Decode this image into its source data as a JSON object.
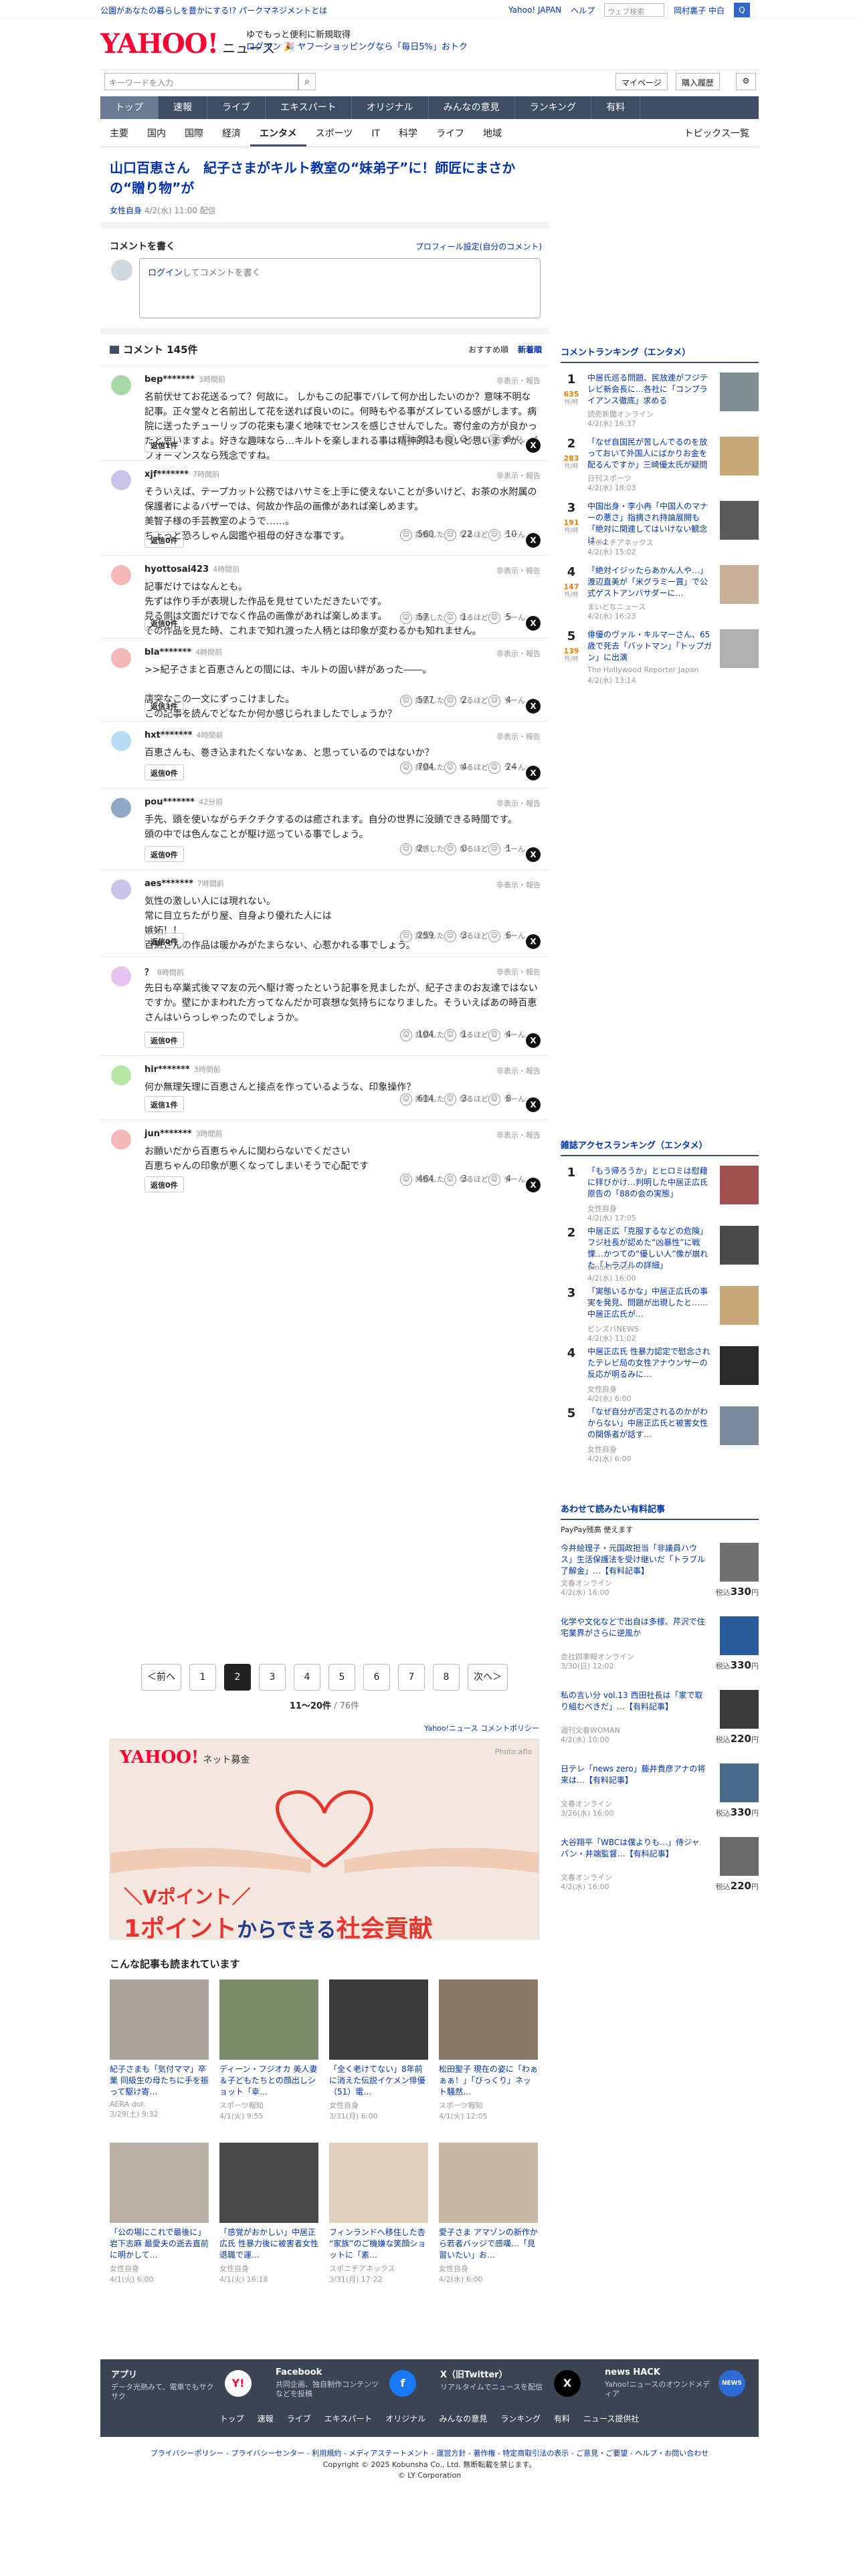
{
  "top": {
    "notice": "公園があなたの暮らしを豊かにする!? パークマネジメントとは",
    "links": [
      "Yahoo! JAPAN",
      "ヘルプ"
    ],
    "search_placeholder": "ウェブ検索",
    "location": "岡村裏子 中白",
    "search_button": "Q"
  },
  "header": {
    "logo": "YAHOO!",
    "logo_sub": "JAPAN",
    "site": "ニュース",
    "promo_line1": "ゆでもっと便利に新規取得",
    "promo_line2": "ログイン 🎉 ヤフーショッピングなら「毎日5%」おトク"
  },
  "searchbar": {
    "placeholder": "キーワードを入力",
    "icon": "search-icon",
    "mypage": "マイページ",
    "purchase": "購入履歴"
  },
  "nav": [
    "トップ",
    "速報",
    "ライブ",
    "エキスパート",
    "オリジナル",
    "みんなの意見",
    "ランキング",
    "有料"
  ],
  "subnav": [
    "主要",
    "国内",
    "国際",
    "経済",
    "エンタメ",
    "スポーツ",
    "IT",
    "科学",
    "ライフ",
    "地域"
  ],
  "subnav_right": "トピックス一覧",
  "article": {
    "title": "山口百恵さん　紀子さまがキルト教室の“妹弟子”に！師匠にまさかの“贈り物”が",
    "source": "女性自身",
    "date": "4/2(水) 11:00 配信"
  },
  "comment_write": {
    "title": "コメントを書く",
    "link": "プロフィール設定(自分のコメント)",
    "placeholder_link": "ログイン",
    "placeholder_rest": "してコメントを書く"
  },
  "comments_header": {
    "title": "コメント 145件",
    "sort_recommended": "おすすめ順",
    "sort_new": "新着順"
  },
  "report_label": "非表示・報告",
  "reaction_labels": {
    "a": "共感した",
    "b": "なるほど",
    "c": "うーん"
  },
  "comments": [
    {
      "user": "bep*******",
      "time": "3時間前",
      "avatar": "#a8d8a8",
      "text": "名前伏せてお花送るって？何故に。 しかもこの記事でバレて何か出したいのか？意味不明な記事。正々堂々と名前出して花を送れば良いのに。何時もやる事がズレている感がします。病院に送ったチューリップの花束も凄く地味でセンスを感じさせんでした。寄付金の方が良かったと思いますよ。好きな趣味なら…キルトを楽しまれる事は精神的にも良いと思いますが、パフォーマンスなら残念ですね。",
      "replies": "返信1件",
      "a": "303",
      "b": "3",
      "c": "8"
    },
    {
      "user": "xjf*******",
      "time": "7時間前",
      "avatar": "#c9c3e8",
      "text": "そういえば、テープカット公務ではハサミを上手に使えないことが多いけど、お茶の水附属の保護者によるバザーでは、何故か作品の画像があれば楽しめます。\n美智子様の手芸教室のようで……。\nちょっと恐ろしゃん図鑑や祖母の好きな事です。",
      "replies": "返信0件",
      "a": "560",
      "b": "22",
      "c": "10"
    },
    {
      "user": "hyottosai423",
      "time": "4時間前",
      "avatar": "#f5b8b8",
      "text": "記事だけではなんとも。\n先ずは作り手が表現した作品を見せていただきたいです。\n見る側は文面だけでなく作品の画像があれば楽しめます。\nその作品を見た時、これまで知れ渡った人柄とは印象が変わるかも知れません。",
      "replies": "返信0件",
      "a": "57",
      "b": "1",
      "c": "5"
    },
    {
      "user": "bla*******",
      "time": "4時間前",
      "avatar": "#f5b8b8",
      "text": ">>紀子さまと百恵さんとの間には、キルトの固い絆があった――。\n\n唐突なこの一文にずっこけました。\nこの記事を読んでどなたか何か感じられましたでしょうか？",
      "replies": "返信3件",
      "a": "577",
      "b": "2",
      "c": "4"
    },
    {
      "user": "hxt*******",
      "time": "4時間前",
      "avatar": "#b8dcf5",
      "text": "百恵さんも、巻き込まれたくないなぁ、と思っているのではないか？",
      "replies": "返信0件",
      "a": "704",
      "b": "4",
      "c": "24"
    },
    {
      "user": "pou*******",
      "time": "42分前",
      "avatar": "#8fa8c8",
      "text": "手先、頭を使いながらチクチクするのは癒されます。自分の世界に没頭できる時間です。\n頭の中では色んなことが駆け巡っている事でしょう。",
      "replies": "返信0件",
      "a": "2",
      "b": "0",
      "c": "1"
    },
    {
      "user": "aes*******",
      "time": "7時間前",
      "avatar": "#c9c3e8",
      "text": "気性の激しい人には現れない。\n常に目立ちたがり屋、自身より優れた人には\n嫉妬！！\n百恵さんの作品は暖かみがたまらない、心惹かれる事でしょう。",
      "replies": "返信0件",
      "a": "259",
      "b": "3",
      "c": "6"
    },
    {
      "user": "？",
      "time": "8時間前",
      "avatar": "#e6c3f0",
      "text": "先日も卒業式後ママ友の元へ駆け寄ったという記事を見ましたが、紀子さまのお友達ではないですか。壁にかまわれた方ってなんだか可哀想な気持ちになりました。そういえばあの時百恵さんはいらっしゃったのでしょうか。",
      "replies": "返信0件",
      "a": "104",
      "b": "1",
      "c": "4"
    },
    {
      "user": "hir*******",
      "time": "3時間前",
      "avatar": "#b8e6a8",
      "text": "何か無理矢理に百恵さんと接点を作っているような、印象操作？",
      "replies": "返信1件",
      "a": "614",
      "b": "3",
      "c": "8"
    },
    {
      "user": "jun*******",
      "time": "3時間前",
      "avatar": "#f5b8b8",
      "text": "お願いだから百恵ちゃんに関わらないでください\n百恵ちゃんの印象が悪くなってしまいそうで心配です",
      "replies": "返信0件",
      "a": "464",
      "b": "3",
      "c": "4"
    }
  ],
  "pager": {
    "prev": "＜前へ",
    "pages": [
      "1",
      "2",
      "3",
      "4",
      "5",
      "6",
      "7",
      "8"
    ],
    "current": "2",
    "next": "次へ＞",
    "info_bold": "11〜20件",
    "info_rest": " / 76件"
  },
  "policy": "Yahoo!ニュース コメントポリシー",
  "ad": {
    "logo": "YAHOO!",
    "logo_sub": "ネット募金",
    "photo": "Photo:aflo",
    "line1": "＼Vポイント／",
    "line2a": "1ポイント",
    "line2b": "からできる",
    "line2c": "社会貢献"
  },
  "recommended_title": "こんな記事も読まれています",
  "recommended": [
    {
      "title": "紀子さまも「気付ママ」卒業 同級生の母たちに手を振って駆け寄…",
      "source": "AERA dot.",
      "date": "3/29(土) 9:32"
    },
    {
      "title": "ディーン・フジオカ 美人妻＆子どもたちとの顔出しショット「幸…",
      "source": "スポーツ報知",
      "date": "4/1(火) 9:55"
    },
    {
      "title": "「全く老けてない」8年前に消えた伝説イケメン俳優（51）電…",
      "source": "女性自身",
      "date": "3/31(月) 6:00"
    },
    {
      "title": "松田聖子 現在の姿に「わぁぁぁ！」「びっくり」ネット騒然…",
      "source": "スポーツ報知",
      "date": "4/1(火) 12:05"
    },
    {
      "title": "「公の場にこれで最後に」岩下志麻 最愛夫の逝去直前に明かして…",
      "source": "女性自身",
      "date": "4/1(火) 6:00"
    },
    {
      "title": "「感覚がおかしい」中居正広氏 性暴力後に被害者女性退職で運…",
      "source": "女性自身",
      "date": "4/1(火) 16:18"
    },
    {
      "title": "フィンランドへ移住した杏 “家族”のご機嫌な笑顔ショットに「素…",
      "source": "スポニチアネックス",
      "date": "3/31(月) 17:22"
    },
    {
      "title": "愛子さま アマゾンの新作から若者バッジで感嘆…「見習いたい」お…",
      "source": "女性自身",
      "date": "4/2(水) 6:00"
    }
  ],
  "sidebar": {
    "ranking_title": "コメントランキング（エンタメ）",
    "ranking": [
      {
        "rank": "1",
        "count": "635",
        "unit": "件/時",
        "title": "中居氏巡る問題、民放連がフジテレビ新会長に…各社に「コンプライアンス徹底」求める",
        "source": "読売新聞オンライン",
        "date": "4/2(水) 16:37"
      },
      {
        "rank": "2",
        "count": "283",
        "unit": "件/時",
        "title": "「なぜ自国民が苦しんでるのを放っておいて外国人にばかりお金を配るんですか」三崎優太氏が疑問",
        "source": "日刊スポーツ",
        "date": "4/2(水) 18:03"
      },
      {
        "rank": "3",
        "count": "191",
        "unit": "件/時",
        "title": "中国出身・李小冉「中国人のマナーの悪さ」指摘され持論展開も「絶対に関連してはいけない観念は…」",
        "source": "スポニチアネックス",
        "date": "4/2(水) 15:02"
      },
      {
        "rank": "4",
        "count": "147",
        "unit": "件/時",
        "title": "「絶対イジッたらあかん人や…」渡辺直美が「米グラミー賞」で公式ゲストアンバサダーに…",
        "source": "まいどなニュース",
        "date": "4/2(水) 16:23"
      },
      {
        "rank": "5",
        "count": "139",
        "unit": "件/時",
        "title": "俳優のヴァル・キルマーさん、65歳で死去「バットマン」「トップガン」に出演",
        "source": "The Hollywood Reporter Japan",
        "date": "4/2(水) 13:14"
      }
    ],
    "magazine_title": "雑誌アクセスランキング（エンタメ）",
    "magazine": [
      {
        "rank": "1",
        "title": "「もう帰ろうか」とヒロミは慰藉に拝びかけ…判明した中居正広氏原告の「88の会の実態」",
        "source": "女性自身",
        "date": "4/2(水) 17:05"
      },
      {
        "rank": "2",
        "title": "中居正広「克服するなどの危険」フジ社長が認めた“凶暴性”に戦慄…かつての“優しい人”像が崩れた「トラブルの詳細」",
        "source": "SmartFLASH",
        "date": "4/2(水) 16:00"
      },
      {
        "rank": "3",
        "title": "「実態いるかな」中居正広氏の事実を発見、問題が出現したと……中居正広氏が…",
        "source": "ピンズバNEWS",
        "date": "4/2(水) 11:02"
      },
      {
        "rank": "4",
        "title": "中居正広氏 性暴力認定で慰念されたテレビ局の女性アナウンサーの反応が明るみに…",
        "source": "女性自身",
        "date": "4/2(水) 6:00"
      },
      {
        "rank": "5",
        "title": "「なぜ自分が否定されるのかがわからない」中居正広氏と被害女性の関係者が話す…",
        "source": "女性自身",
        "date": "4/2(水) 6:00"
      }
    ],
    "paid_title": "あわせて読みたい有料記事",
    "paypay": "PayPay残高 使えます",
    "paid": [
      {
        "title": "今井絵理子・元国政担当「非議員ハウス」生活保護法を受け継いだ「トラブル了解金」…【有料記事】",
        "source": "文春オンライン",
        "date": "4/2(水) 16:00",
        "price": "330"
      },
      {
        "title": "化学や文化などで出自は多様、芹沢で住宅業界がさらに逆風か",
        "source": "会社四季報オンライン",
        "date": "3/30(日) 12:02",
        "price": "330"
      },
      {
        "title": "私の言い分 vol.13 西田社長は「家で取り組むべきだ」…【有料記事】",
        "source": "週刊文春WOMAN",
        "date": "4/2(水) 10:00",
        "price": "220"
      },
      {
        "title": "日テレ「news zero」藤井貴彦アナの将来は…【有料記事】",
        "source": "文春オンライン",
        "date": "3/26(水) 16:00",
        "price": "330"
      },
      {
        "title": "大谷翔平「WBCは僕よりも…」侍ジャパン・井端監督…【有料記事】",
        "source": "文春オンライン",
        "date": "4/2(水) 16:00",
        "price": "220"
      }
    ],
    "price_prefix": "税込",
    "price_suffix": "円"
  },
  "footer": {
    "items": [
      {
        "name": "アプリ",
        "desc": "データ光熱みて、電車でもサクサク",
        "icon": "app-icon"
      },
      {
        "name": "Facebook",
        "desc": "共同企画、独自制作コンテンツなどを投稿",
        "icon": "facebook-icon"
      },
      {
        "name": "X（旧Twitter）",
        "desc": "リアルタイムでニュースを配信",
        "icon": "x-icon"
      },
      {
        "name": "news HACK",
        "desc": "Yahoo!ニュースのオウンドメディア",
        "icon": "newshack-icon"
      }
    ],
    "nav": [
      "トップ",
      "速報",
      "ライブ",
      "エキスパート",
      "オリジナル",
      "みんなの意見",
      "ランキング",
      "有料",
      "ニュース提供社"
    ],
    "legal": "プライバシーポリシー - プライバシーセンター - 利用規約 - メディアステートメント - 運営方針 - 著作権 - 特定商取引法の表示 - ご意見・ご要望 - ヘルプ・お問い合わせ",
    "copy1": "Copyright © 2025 Kobunsha Co., Ltd. 無断転載を禁じます。",
    "copy2": "© LY Corporation"
  }
}
